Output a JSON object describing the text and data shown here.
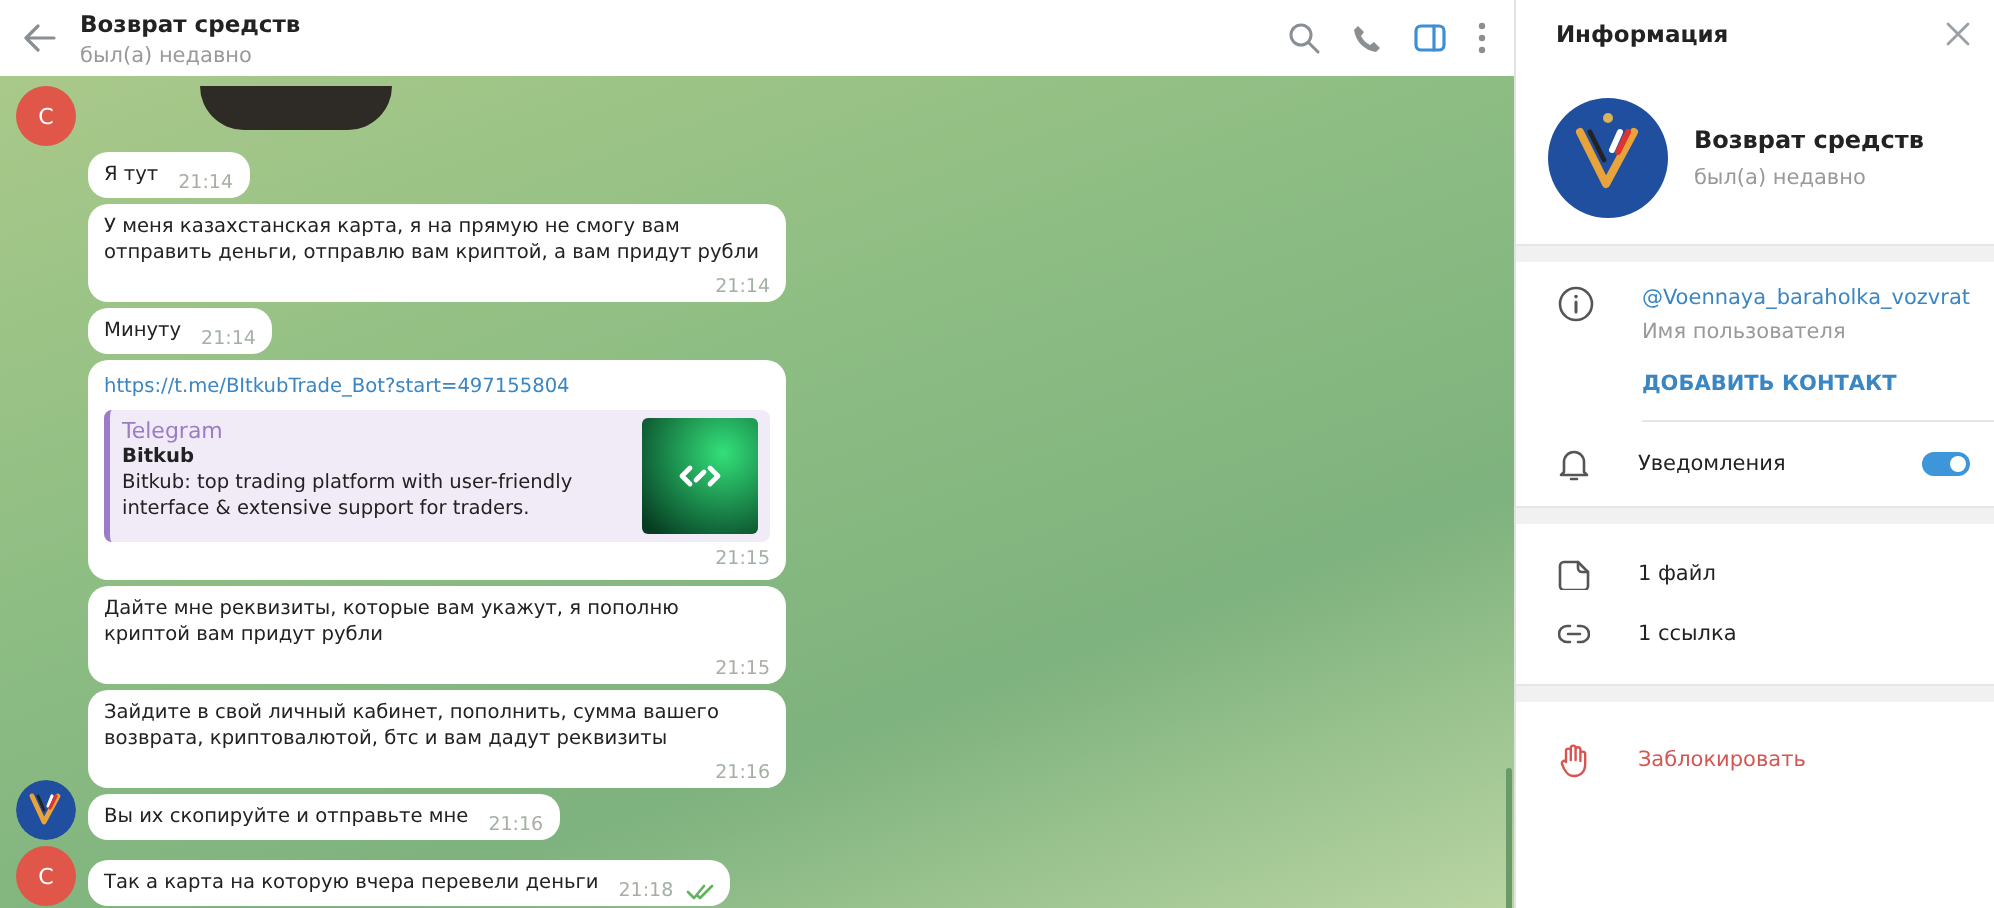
{
  "header": {
    "title": "Возврат средств",
    "status": "был(а) недавно",
    "sidebar_toggle_on": true
  },
  "groups": [
    {
      "avatar": {
        "kind": "letter",
        "letter": "С",
        "color": "#e0574a"
      },
      "messages": [
        {
          "kind": "sticker"
        }
      ]
    },
    {
      "avatar": {
        "kind": "image"
      },
      "messages": [
        {
          "kind": "text",
          "text": "Я тут",
          "time": "21:14"
        },
        {
          "kind": "text",
          "text": "У меня казахстанская карта, я на прямую не смогу вам отправить деньги, отправлю вам криптой, а вам придут рубли",
          "time": "21:14"
        },
        {
          "kind": "text",
          "text": "Минуту",
          "time": "21:14"
        },
        {
          "kind": "link",
          "url": "https://t.me/BItkubTrade_Bot?start=497155804",
          "site": "Telegram",
          "title": "Bitkub",
          "description": "Bitkub: top trading platform with user-friendly interface & extensive support for traders.",
          "time": "21:15"
        },
        {
          "kind": "text",
          "text": "Дайте мне реквизиты, которые вам укажут, я пополню криптой вам придут рубли",
          "time": "21:15"
        },
        {
          "kind": "text",
          "text": "Зайдите в свой личный кабинет, пополнить, сумма вашего возврата, криптовалютой, бтс и вам дадут реквизиты",
          "time": "21:16"
        },
        {
          "kind": "text",
          "text": "Вы их скопируйте и отправьте мне",
          "time": "21:16"
        }
      ]
    },
    {
      "avatar": {
        "kind": "letter",
        "letter": "С",
        "color": "#e0574a"
      },
      "messages": [
        {
          "kind": "text",
          "text": "Так а карта на которую вчера перевели деньги",
          "time": "21:18",
          "read": true
        }
      ]
    }
  ],
  "info_panel": {
    "title": "Информация",
    "name": "Возврат средств",
    "status": "был(а) недавно",
    "username": "@Voennaya_baraholka_vozvrat",
    "username_label": "Имя пользователя",
    "add_contact": "ДОБАВИТЬ КОНТАКТ",
    "notifications": {
      "label": "Уведомления",
      "on": true
    },
    "media": [
      "1 файл",
      "1 ссылка"
    ],
    "block": "Заблокировать"
  }
}
